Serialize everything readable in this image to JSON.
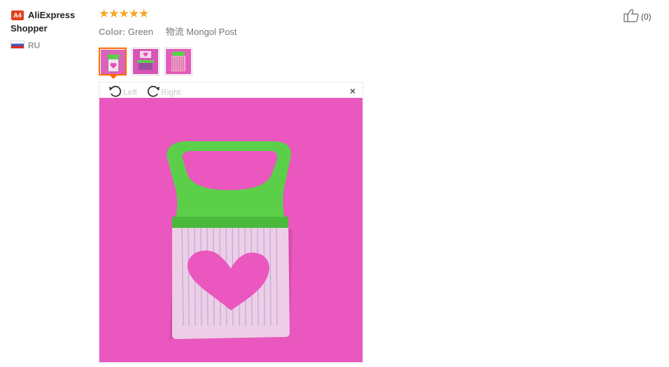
{
  "user": {
    "badge": "A4",
    "name_first": "AliExpress",
    "name_second": "Shopper",
    "country": "RU"
  },
  "review": {
    "stars": "★★★★★",
    "rating": 5,
    "color_label": "Color:",
    "color_value": "Green",
    "shipping": "物流 Mongol Post"
  },
  "viewer": {
    "rotate_left": "Left",
    "rotate_right": "Right",
    "close": "×"
  },
  "like": {
    "count": "(0)"
  },
  "colors": {
    "accent": "#ff6a00",
    "star": "#f5a623",
    "badge": "#e0411c",
    "photo_bg": "#e957bf",
    "handle": "#5ccf4a"
  },
  "icons": [
    "rotate-left-icon",
    "rotate-right-icon",
    "close-icon",
    "thumbs-up-icon",
    "flag-ru-icon"
  ]
}
